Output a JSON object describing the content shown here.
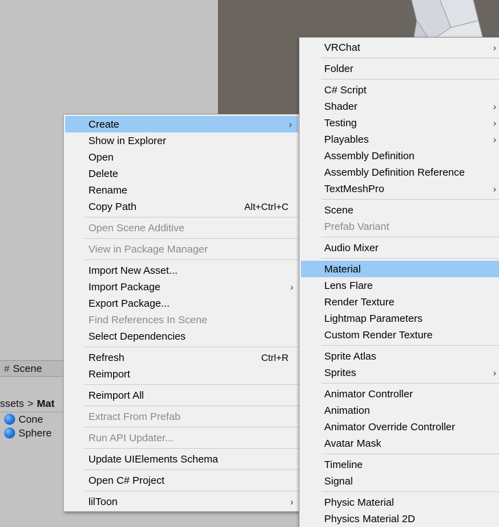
{
  "background": {
    "scene_tab": {
      "icon": "grid-hash-icon",
      "label": "Scene"
    },
    "breadcrumb": {
      "part1": "ssets",
      "separator": ">",
      "part2": "Mat"
    },
    "assets": [
      {
        "icon": "sphere-material-icon",
        "label": "Cone"
      },
      {
        "icon": "sphere-material-icon",
        "label": "Sphere"
      }
    ]
  },
  "context_menu": {
    "groups": [
      [
        {
          "label": "Create",
          "submenu": true,
          "highlighted": true
        },
        {
          "label": "Show in Explorer"
        },
        {
          "label": "Open"
        },
        {
          "label": "Delete"
        },
        {
          "label": "Rename"
        },
        {
          "label": "Copy Path",
          "shortcut": "Alt+Ctrl+C"
        }
      ],
      [
        {
          "label": "Open Scene Additive",
          "disabled": true
        }
      ],
      [
        {
          "label": "View in Package Manager",
          "disabled": true
        }
      ],
      [
        {
          "label": "Import New Asset..."
        },
        {
          "label": "Import Package",
          "submenu": true
        },
        {
          "label": "Export Package..."
        },
        {
          "label": "Find References In Scene",
          "disabled": true
        },
        {
          "label": "Select Dependencies"
        }
      ],
      [
        {
          "label": "Refresh",
          "shortcut": "Ctrl+R"
        },
        {
          "label": "Reimport"
        }
      ],
      [
        {
          "label": "Reimport All"
        }
      ],
      [
        {
          "label": "Extract From Prefab",
          "disabled": true
        }
      ],
      [
        {
          "label": "Run API Updater...",
          "disabled": true
        }
      ],
      [
        {
          "label": "Update UIElements Schema"
        }
      ],
      [
        {
          "label": "Open C# Project"
        }
      ],
      [
        {
          "label": "lilToon",
          "submenu": true
        }
      ]
    ]
  },
  "create_submenu": {
    "groups": [
      [
        {
          "label": "VRChat",
          "submenu": true
        }
      ],
      [
        {
          "label": "Folder"
        }
      ],
      [
        {
          "label": "C# Script"
        },
        {
          "label": "Shader",
          "submenu": true
        },
        {
          "label": "Testing",
          "submenu": true
        },
        {
          "label": "Playables",
          "submenu": true
        },
        {
          "label": "Assembly Definition"
        },
        {
          "label": "Assembly Definition Reference"
        },
        {
          "label": "TextMeshPro",
          "submenu": true
        }
      ],
      [
        {
          "label": "Scene"
        },
        {
          "label": "Prefab Variant",
          "disabled": true
        }
      ],
      [
        {
          "label": "Audio Mixer"
        }
      ],
      [
        {
          "label": "Material",
          "highlighted": true
        },
        {
          "label": "Lens Flare"
        },
        {
          "label": "Render Texture"
        },
        {
          "label": "Lightmap Parameters"
        },
        {
          "label": "Custom Render Texture"
        }
      ],
      [
        {
          "label": "Sprite Atlas"
        },
        {
          "label": "Sprites",
          "submenu": true
        }
      ],
      [
        {
          "label": "Animator Controller"
        },
        {
          "label": "Animation"
        },
        {
          "label": "Animator Override Controller"
        },
        {
          "label": "Avatar Mask"
        }
      ],
      [
        {
          "label": "Timeline"
        },
        {
          "label": "Signal"
        }
      ],
      [
        {
          "label": "Physic Material"
        },
        {
          "label": "Physics Material 2D"
        }
      ]
    ]
  },
  "arrow_glyph": "›"
}
